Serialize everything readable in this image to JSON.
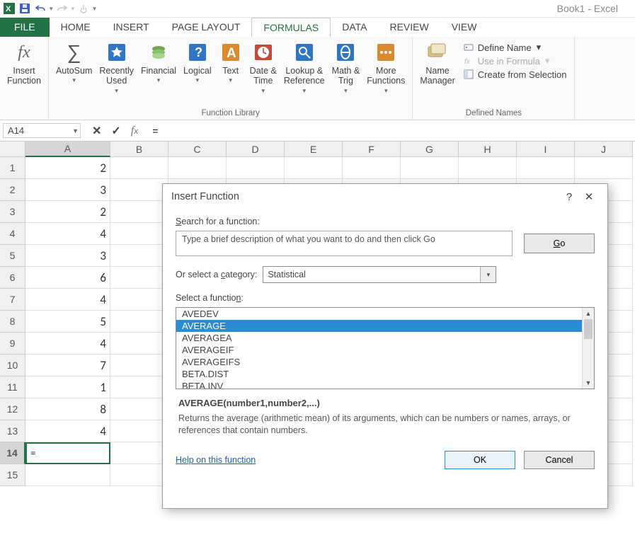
{
  "app": {
    "title": "Book1 - Excel"
  },
  "tabs": {
    "file": "FILE",
    "home": "HOME",
    "insert": "INSERT",
    "pagelayout": "PAGE LAYOUT",
    "formulas": "FORMULAS",
    "data": "DATA",
    "review": "REVIEW",
    "view": "VIEW"
  },
  "ribbon": {
    "insert_function": "Insert\nFunction",
    "autosum": "AutoSum",
    "recently_used": "Recently\nUsed",
    "financial": "Financial",
    "logical": "Logical",
    "text": "Text",
    "datetime": "Date &\nTime",
    "lookup": "Lookup &\nReference",
    "math": "Math &\nTrig",
    "more": "More\nFunctions",
    "group_fl": "Function Library",
    "name_mgr": "Name\nManager",
    "define": "Define Name",
    "useinf": "Use in Formula",
    "createsel": "Create from Selection",
    "group_dn": "Defined Names"
  },
  "fbar": {
    "name": "A14",
    "formula": "="
  },
  "grid": {
    "cols": [
      "A",
      "B",
      "C",
      "D",
      "E",
      "F",
      "G",
      "H",
      "I",
      "J"
    ],
    "rows": [
      {
        "n": "1",
        "A": "2"
      },
      {
        "n": "2",
        "A": "3"
      },
      {
        "n": "3",
        "A": "2"
      },
      {
        "n": "4",
        "A": "4"
      },
      {
        "n": "5",
        "A": "3"
      },
      {
        "n": "6",
        "A": "6"
      },
      {
        "n": "7",
        "A": "4"
      },
      {
        "n": "8",
        "A": "5"
      },
      {
        "n": "9",
        "A": "4"
      },
      {
        "n": "10",
        "A": "7"
      },
      {
        "n": "11",
        "A": "1"
      },
      {
        "n": "12",
        "A": "8"
      },
      {
        "n": "13",
        "A": "4"
      },
      {
        "n": "14",
        "A": "="
      },
      {
        "n": "15",
        "A": ""
      }
    ],
    "active": {
      "row": 14,
      "col": "A"
    }
  },
  "dialog": {
    "title": "Insert Function",
    "search_label": "Search for a function:",
    "search_placeholder": "Type a brief description of what you want to do and then click Go",
    "go": "Go",
    "cat_label": "Or select a category:",
    "cat_value": "Statistical",
    "selectf_label": "Select a function:",
    "functions": [
      "AVEDEV",
      "AVERAGE",
      "AVERAGEA",
      "AVERAGEIF",
      "AVERAGEIFS",
      "BETA.DIST",
      "BETA.INV"
    ],
    "selected": "AVERAGE",
    "signature": "AVERAGE(number1,number2,...)",
    "description": "Returns the average (arithmetic mean) of its arguments, which can be numbers or names, arrays, or references that contain numbers.",
    "help": "Help on this function",
    "ok": "OK",
    "cancel": "Cancel"
  }
}
